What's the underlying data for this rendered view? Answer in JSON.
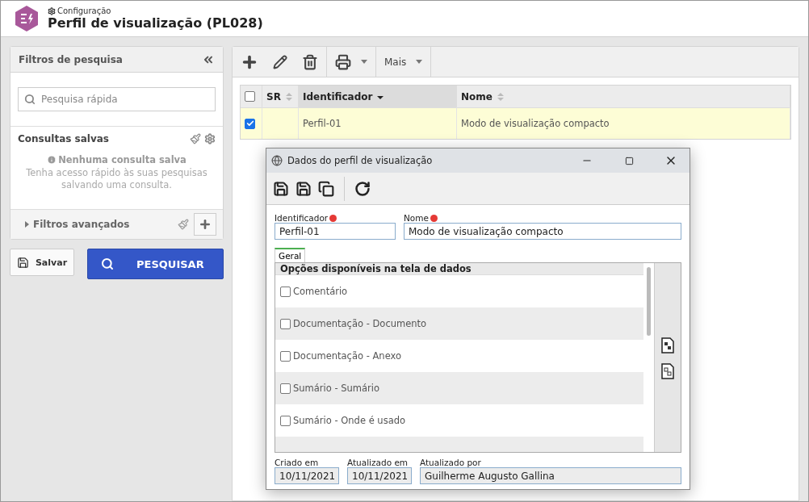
{
  "header": {
    "breadcrumb": "Configuração",
    "title": "Perfil de visualização (PL028)"
  },
  "filters": {
    "title": "Filtros de pesquisa",
    "search": {
      "placeholder": "Pesquisa rápida"
    },
    "saved_title": "Consultas salvas",
    "empty_title": "Nenhuma consulta salva",
    "empty_text": "Tenha acesso rápido às suas pesquisas salvando uma consulta.",
    "advanced": {
      "label": "Filtros avançados",
      "expanded": false
    }
  },
  "buttons": {
    "save": "Salvar",
    "search": "PESQUISAR"
  },
  "toolbar": {
    "more": "Mais"
  },
  "table": {
    "all_checked": false,
    "columns": [
      {
        "label": "SR",
        "sorted": false
      },
      {
        "label": "Identificador",
        "sorted": true
      },
      {
        "label": "Nome",
        "sorted": false
      }
    ],
    "rows": [
      {
        "checked": true,
        "selected": true,
        "identifier": "Perfil-01",
        "name": "Modo de visualização compacto"
      }
    ]
  },
  "dialog": {
    "title": "Dados do perfil de visualização",
    "fields": [
      {
        "label": "Identificador",
        "required": true,
        "value": "Perfil-01"
      },
      {
        "label": "Nome",
        "required": true,
        "value": "Modo de visualização compacto"
      }
    ],
    "tabs": [
      {
        "label": "Geral",
        "selected": true
      }
    ],
    "list": {
      "title": "Opções disponíveis na tela de dados",
      "options": [
        {
          "label": "Comentário",
          "checked": false
        },
        {
          "label": "Documentação - Documento",
          "checked": false
        },
        {
          "label": "Documentação - Anexo",
          "checked": false
        },
        {
          "label": "Sumário - Sumário",
          "checked": false
        },
        {
          "label": "Sumário - Onde é usado",
          "checked": false
        }
      ]
    },
    "footer": [
      {
        "label": "Criado em",
        "value": "10/11/2021"
      },
      {
        "label": "Atualizado em",
        "value": "10/11/2021"
      },
      {
        "label": "Atualizado por",
        "value": "Guilherme Augusto Gallina"
      }
    ]
  }
}
